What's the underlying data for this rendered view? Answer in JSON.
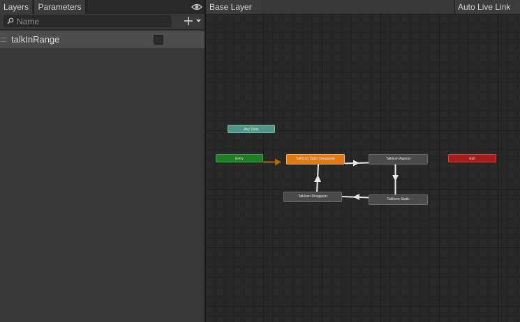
{
  "left_panel": {
    "tabs": {
      "layers": "Layers",
      "parameters": "Parameters"
    },
    "search": {
      "placeholder": "Name"
    },
    "parameters": [
      {
        "name": "talkInRange",
        "type": "bool",
        "value": false
      }
    ]
  },
  "right_panel": {
    "breadcrumb": "Base Layer",
    "auto_live_link": "Auto Live Link"
  },
  "states": {
    "any_state": "Any State",
    "entry": "Entry",
    "exit": "Exit",
    "static_disappear": "TalkIcon Static Disappear",
    "appear": "TalkIcon Appear",
    "static": "TalkIcon Static",
    "disappear": "TalkIcon Disappear"
  },
  "colors": {
    "entry": "#1e7b26",
    "exit": "#a41b1b",
    "any_state": "#4f9586",
    "default_state": "#e07b12",
    "state": "#4a4a4a",
    "transition": "#e8e8e8",
    "default_transition": "#b06a00"
  }
}
